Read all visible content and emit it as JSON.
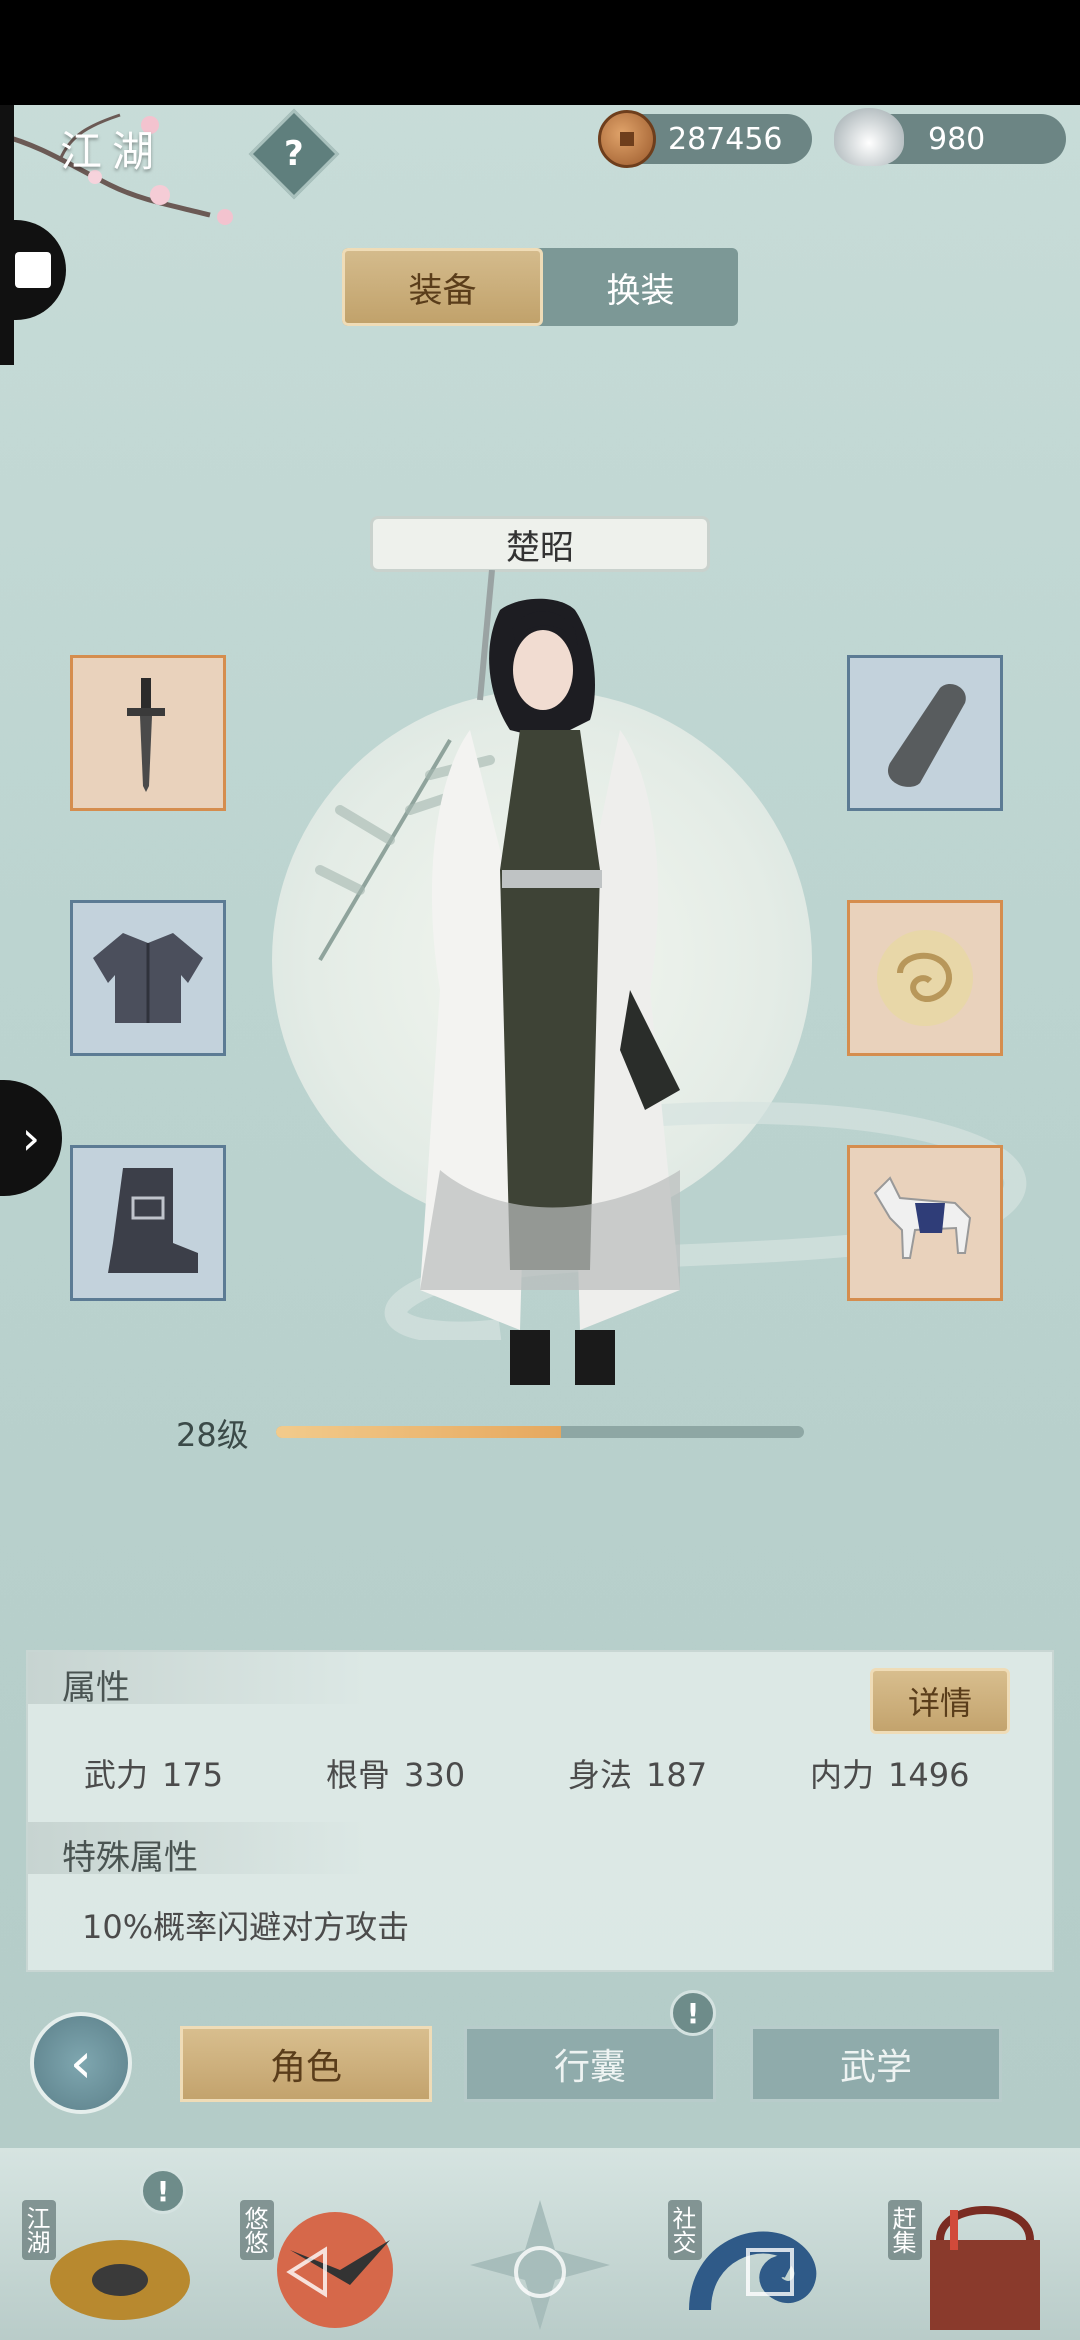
{
  "header": {
    "title": "江湖",
    "help_icon": "question-icon"
  },
  "currency": {
    "copper": "287456",
    "silver": "980"
  },
  "tabs": {
    "equip": "装备",
    "outfit": "换装",
    "active": "装备"
  },
  "character": {
    "name": "楚昭",
    "level": "28级",
    "level_progress": 0.54
  },
  "slots": [
    {
      "name": "weapon-slot",
      "icon": "dagger-icon",
      "rarity": "orange"
    },
    {
      "name": "armor-slot",
      "icon": "robe-icon",
      "rarity": "blue"
    },
    {
      "name": "boots-slot",
      "icon": "boot-icon",
      "rarity": "blue"
    },
    {
      "name": "bracer-slot",
      "icon": "bracer-icon",
      "rarity": "blue"
    },
    {
      "name": "accessory-slot",
      "icon": "jade-pendant-icon",
      "rarity": "orange"
    },
    {
      "name": "mount-slot",
      "icon": "horse-icon",
      "rarity": "orange"
    }
  ],
  "attributes": {
    "title": "属性",
    "detail_label": "详情",
    "stats": [
      {
        "label": "武力",
        "value": "175"
      },
      {
        "label": "根骨",
        "value": "330"
      },
      {
        "label": "身法",
        "value": "187"
      },
      {
        "label": "内力",
        "value": "1496"
      }
    ],
    "special_title": "特殊属性",
    "special_text": "10%概率闪避对方攻击"
  },
  "nav": {
    "role": "角色",
    "bag": "行囊",
    "martial": "武学",
    "alert": "!"
  },
  "dock": {
    "jianghu": "江湖",
    "youyou": "悠悠",
    "social": "社交",
    "market": "赶集",
    "alert": "!"
  },
  "colors": {
    "accent_gold": "#c3a36d",
    "bg_teal": "#bcd4d0",
    "rarity_orange": "#d58d4e",
    "rarity_blue": "#5c7b94"
  }
}
